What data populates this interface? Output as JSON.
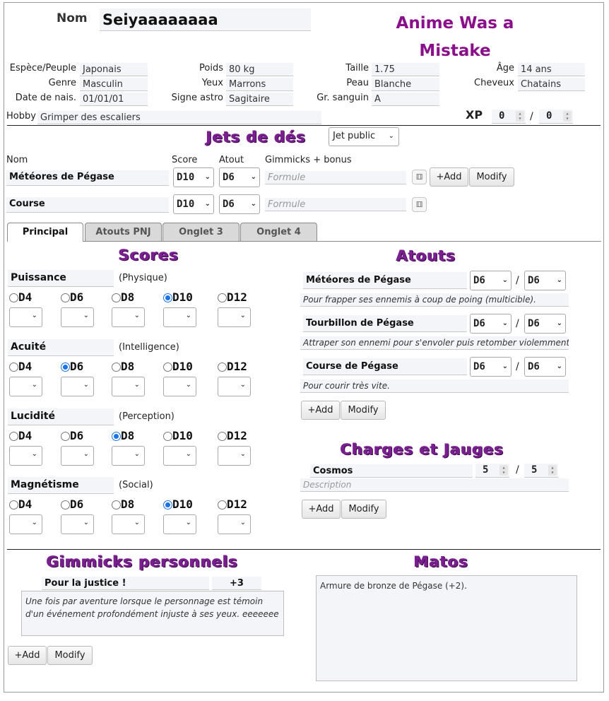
{
  "header": {
    "nom_label": "Nom",
    "nom_value": "Seiyaaaaaaaa",
    "title": "Anime Was a Mistake"
  },
  "identity": {
    "espece_label": "Espèce/Peuple",
    "espece": "Japonais",
    "genre_label": "Genre",
    "genre": "Masculin",
    "date_label": "Date de nais.",
    "date": "01/01/01",
    "poids_label": "Poids",
    "poids": "80 kg",
    "yeux_label": "Yeux",
    "yeux": "Marrons",
    "signe_label": "Signe astro",
    "signe": "Sagitaire",
    "taille_label": "Taille",
    "taille": "1.75",
    "peau_label": "Peau",
    "peau": "Blanche",
    "sang_label": "Gr. sanguin",
    "sang": "A",
    "age_label": "Âge",
    "age": "14 ans",
    "cheveux_label": "Cheveux",
    "cheveux": "Chatains",
    "hobby_label": "Hobby",
    "hobby": "Grimper des escaliers",
    "xp_label": "XP",
    "xp_current": "0",
    "xp_sep": "/",
    "xp_max": "0"
  },
  "jets": {
    "title": "Jets de dés",
    "visibility": "Jet public",
    "col_nom": "Nom",
    "col_score": "Score",
    "col_atout": "Atout",
    "col_gimmicks": "Gimmicks + bonus",
    "rows": [
      {
        "name": "Météores de Pégase",
        "score": "D10",
        "atout": "D6",
        "formula": "Formule"
      },
      {
        "name": "Course",
        "score": "D10",
        "atout": "D6",
        "formula": "Formule"
      }
    ],
    "add": "+Add",
    "modify": "Modify"
  },
  "tabs": [
    "Principal",
    "Atouts PNJ",
    "Onglet 3",
    "Onglet 4"
  ],
  "scores": {
    "title": "Scores",
    "dice": [
      "D4",
      "D6",
      "D8",
      "D10",
      "D12"
    ],
    "items": [
      {
        "name": "Puissance",
        "sub": "(Physique)",
        "selected": "D10"
      },
      {
        "name": "Acuité",
        "sub": "(Intelligence)",
        "selected": "D6"
      },
      {
        "name": "Lucidité",
        "sub": "(Perception)",
        "selected": "D8"
      },
      {
        "name": "Magnétisme",
        "sub": "(Social)",
        "selected": "D10"
      }
    ]
  },
  "atouts": {
    "title": "Atouts",
    "sep": "/",
    "items": [
      {
        "name": "Météores de Pégase",
        "d1": "D6",
        "d2": "D6",
        "desc": "Pour frapper ses ennemis à coup de poing (multicible)."
      },
      {
        "name": "Tourbillon de Pégase",
        "d1": "D6",
        "d2": "D6",
        "desc": "Attraper son ennemi pour s'envoler puis retomber violemment."
      },
      {
        "name": "Course de Pégase",
        "d1": "D6",
        "d2": "D6",
        "desc": "Pour courir très vite."
      }
    ],
    "add": "+Add",
    "modify": "Modify"
  },
  "charges": {
    "title": "Charges et Jauges",
    "name": "Cosmos",
    "current": "5",
    "sep": "/",
    "max": "5",
    "desc_placeholder": "Description",
    "add": "+Add",
    "modify": "Modify"
  },
  "gimmicks": {
    "title": "Gimmicks personnels",
    "name": "Pour la justice !",
    "bonus": "+3",
    "desc": "Une fois par aventure lorsque le personnage est témoin d'un événement profondément injuste à ses yeux. eeeeeee",
    "add": "+Add",
    "modify": "Modify"
  },
  "matos": {
    "title": "Matos",
    "text": "Armure de bronze de Pégase (+2)."
  },
  "colors": {
    "accent": "#7a1f8f",
    "radio": "#1a73e8"
  }
}
